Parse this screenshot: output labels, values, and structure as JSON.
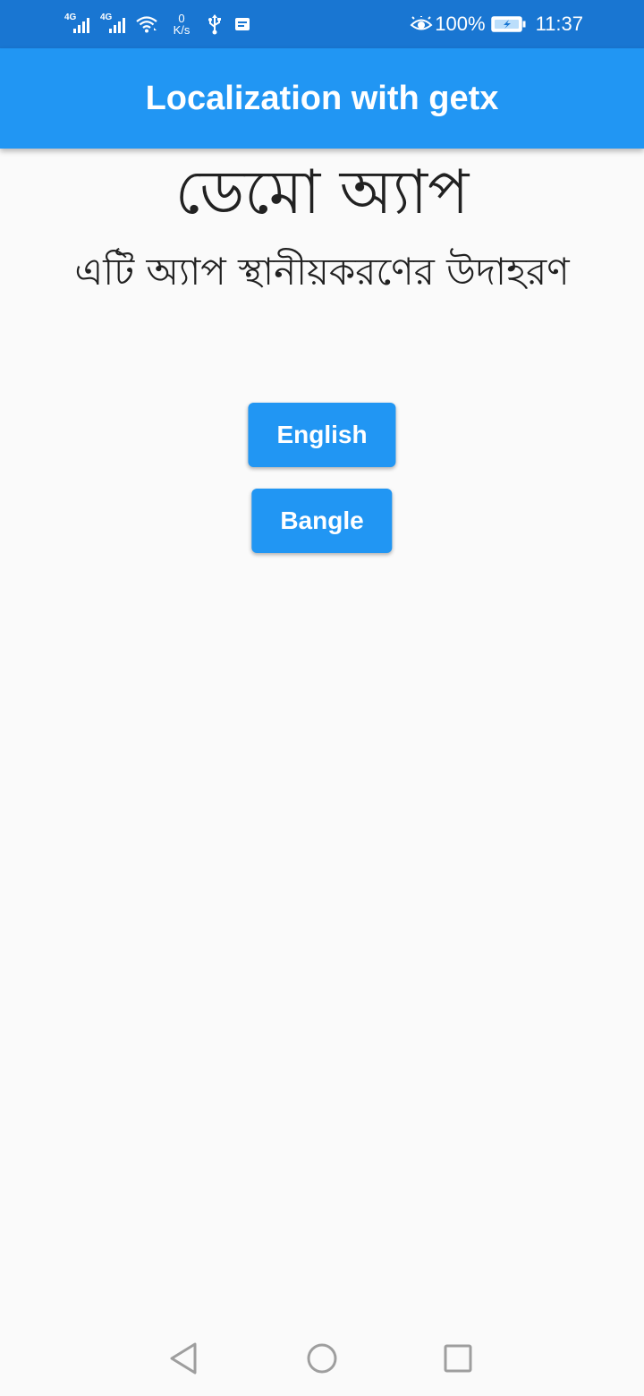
{
  "status_bar": {
    "network_1": "4G",
    "network_2": "4G",
    "speed_value": "0",
    "speed_unit": "K/s",
    "battery_percent": "100%",
    "time": "11:37",
    "icons": [
      "signal-icon",
      "signal-icon",
      "wifi-icon",
      "usb-icon",
      "notification-icon",
      "eye-icon",
      "battery-charging-icon"
    ]
  },
  "app_bar": {
    "title": "Localization with getx"
  },
  "main": {
    "heading": "ডেমো অ্যাপ",
    "subheading": "এটি অ্যাপ স্থানীয়করণের উদাহরণ"
  },
  "buttons": {
    "english_label": "English",
    "bangle_label": "Bangle"
  },
  "nav_bar": {
    "icons": [
      "back-icon",
      "home-icon",
      "recent-apps-icon"
    ]
  },
  "colors": {
    "app_bar": "#2196f3",
    "status_bar": "#1976d2",
    "background": "#fafafa",
    "text": "#212121",
    "button": "#2196f3",
    "button_text": "#ffffff"
  }
}
